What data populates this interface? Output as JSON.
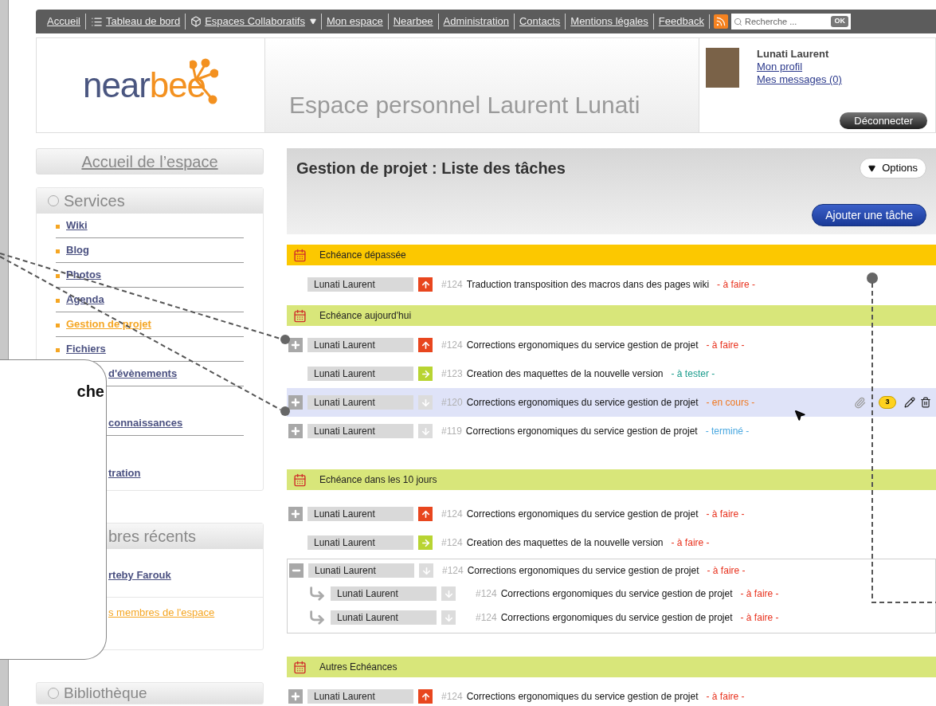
{
  "nav": {
    "items": [
      {
        "label": "Accueil",
        "kind": "plain"
      },
      {
        "label": "Tableau de bord",
        "kind": "list"
      },
      {
        "label": "Espaces Collaboratifs",
        "kind": "menu"
      },
      {
        "label": "Mon espace",
        "kind": "plain"
      },
      {
        "label": "Nearbee",
        "kind": "plain"
      },
      {
        "label": "Administration",
        "kind": "plain"
      },
      {
        "label": "Contacts",
        "kind": "plain"
      },
      {
        "label": "Mentions légales",
        "kind": "plain"
      },
      {
        "label": "Feedback",
        "kind": "plain"
      }
    ],
    "search": {
      "placeholder": "Recherche ...",
      "button": "OK"
    }
  },
  "header": {
    "logo": [
      "near",
      "bee"
    ],
    "title": "Espace personnel Laurent Lunati",
    "user": {
      "name": "Lunati Laurent",
      "links": [
        "Mon profil",
        "Mes messages (0)"
      ],
      "logout": "Déconnecter"
    }
  },
  "sidebar": {
    "home": "Accueil de l’espace",
    "services": {
      "title": "Services",
      "items": [
        {
          "label": "Wiki",
          "kind": "link",
          "selected": false
        },
        {
          "label": "Blog",
          "kind": "link",
          "selected": false
        },
        {
          "label": "Photos",
          "kind": "link",
          "selected": false
        },
        {
          "label": "Agenda",
          "kind": "link",
          "selected": false
        },
        {
          "label": "Gestion de projet",
          "kind": "link",
          "selected": true
        },
        {
          "label": "Fichiers",
          "kind": "link",
          "selected": false
        },
        {
          "label": "d'évènements",
          "kind": "clipped",
          "selected": false
        },
        {
          "label": "connaissances",
          "kind": "clipped_tall",
          "selected": false
        },
        {
          "label": "tration",
          "kind": "clipped_tall",
          "selected": false
        }
      ]
    },
    "members": {
      "title": "bres récents",
      "member": "rteby Farouk",
      "all_link": "s membres de l'espace"
    },
    "library": {
      "title": "Bibliothèque"
    }
  },
  "callout": {
    "text": "che"
  },
  "main": {
    "title": "Gestion de projet : Liste des tâches",
    "options": "Options",
    "add": "Ajouter une tâche",
    "sections": [
      {
        "title": "Echéance dépassée",
        "color": "#fcc800",
        "tasks": [
          {
            "expandable": false,
            "assignee": "Lunati Laurent",
            "kind": "high",
            "id": "#124",
            "title": "Traduction transposition des macros dans des pages wiki",
            "status": "- à faire -",
            "color": "#e8321e",
            "selected": false
          }
        ]
      },
      {
        "title": "Echéance aujourd'hui",
        "color": "#d8e67a",
        "tasks": [
          {
            "expandable": true,
            "expanded": false,
            "assignee": "Lunati Laurent",
            "kind": "high",
            "id": "#124",
            "title": "Corrections ergonomiques du service gestion de projet",
            "status": "- à faire -",
            "color": "#e8321e",
            "selected": false
          },
          {
            "expandable": false,
            "assignee": "Lunati Laurent",
            "kind": "medium",
            "id": "#123",
            "title": "Creation des maquettes de la nouvelle version",
            "status": "- à tester -",
            "color": "#1a9c8c",
            "selected": false
          },
          {
            "expandable": true,
            "expanded": false,
            "assignee": "Lunati Laurent",
            "kind": "low",
            "id": "#120",
            "title": "Corrections ergonomiques du service gestion de projet",
            "status": "- en cours -",
            "color": "#f07820",
            "selected": true,
            "comments": "3"
          },
          {
            "expandable": true,
            "expanded": false,
            "assignee": "Lunati Laurent",
            "kind": "low",
            "id": "#119",
            "title": "Corrections ergonomiques du service gestion de projet",
            "status": "- terminé -",
            "color": "#4aa8e0",
            "selected": false
          }
        ]
      },
      {
        "title": "Echéance dans les 10 jours",
        "color": "#d8e67a",
        "tasks": [
          {
            "expandable": true,
            "expanded": false,
            "assignee": "Lunati Laurent",
            "kind": "high",
            "id": "#124",
            "title": "Corrections ergonomiques du service gestion de projet",
            "status": "- à faire -",
            "color": "#e8321e",
            "selected": false
          },
          {
            "expandable": false,
            "assignee": "Lunati Laurent",
            "kind": "medium",
            "id": "#124",
            "title": "Creation des maquettes de la nouvelle version",
            "status": "- à faire -",
            "color": "#e8321e",
            "selected": false
          },
          {
            "expandable": true,
            "expanded": true,
            "assignee": "Lunati Laurent",
            "kind": "low",
            "id": "#124",
            "title": "Corrections ergonomiques du service gestion de projet",
            "status": "- à faire -",
            "color": "#e8321e",
            "selected": false,
            "children": [
              {
                "assignee": "Lunati Laurent",
                "kind": "low",
                "id": "#124",
                "title": "Corrections ergonomiques du service gestion de projet",
                "status": "- à faire -",
                "color": "#e8321e"
              },
              {
                "assignee": "Lunati Laurent",
                "kind": "low",
                "id": "#124",
                "title": "Corrections ergonomiques du service gestion de projet",
                "status": "- à faire -",
                "color": "#e8321e"
              }
            ]
          }
        ]
      },
      {
        "title": "Autres Echéances",
        "color": "#d8e67a",
        "tasks": [
          {
            "expandable": true,
            "expanded": false,
            "assignee": "Lunati Laurent",
            "kind": "high",
            "id": "#124",
            "title": "Corrections ergonomiques du service gestion de projet",
            "status": "- à faire -",
            "color": "#e8321e",
            "selected": false
          }
        ]
      }
    ]
  }
}
